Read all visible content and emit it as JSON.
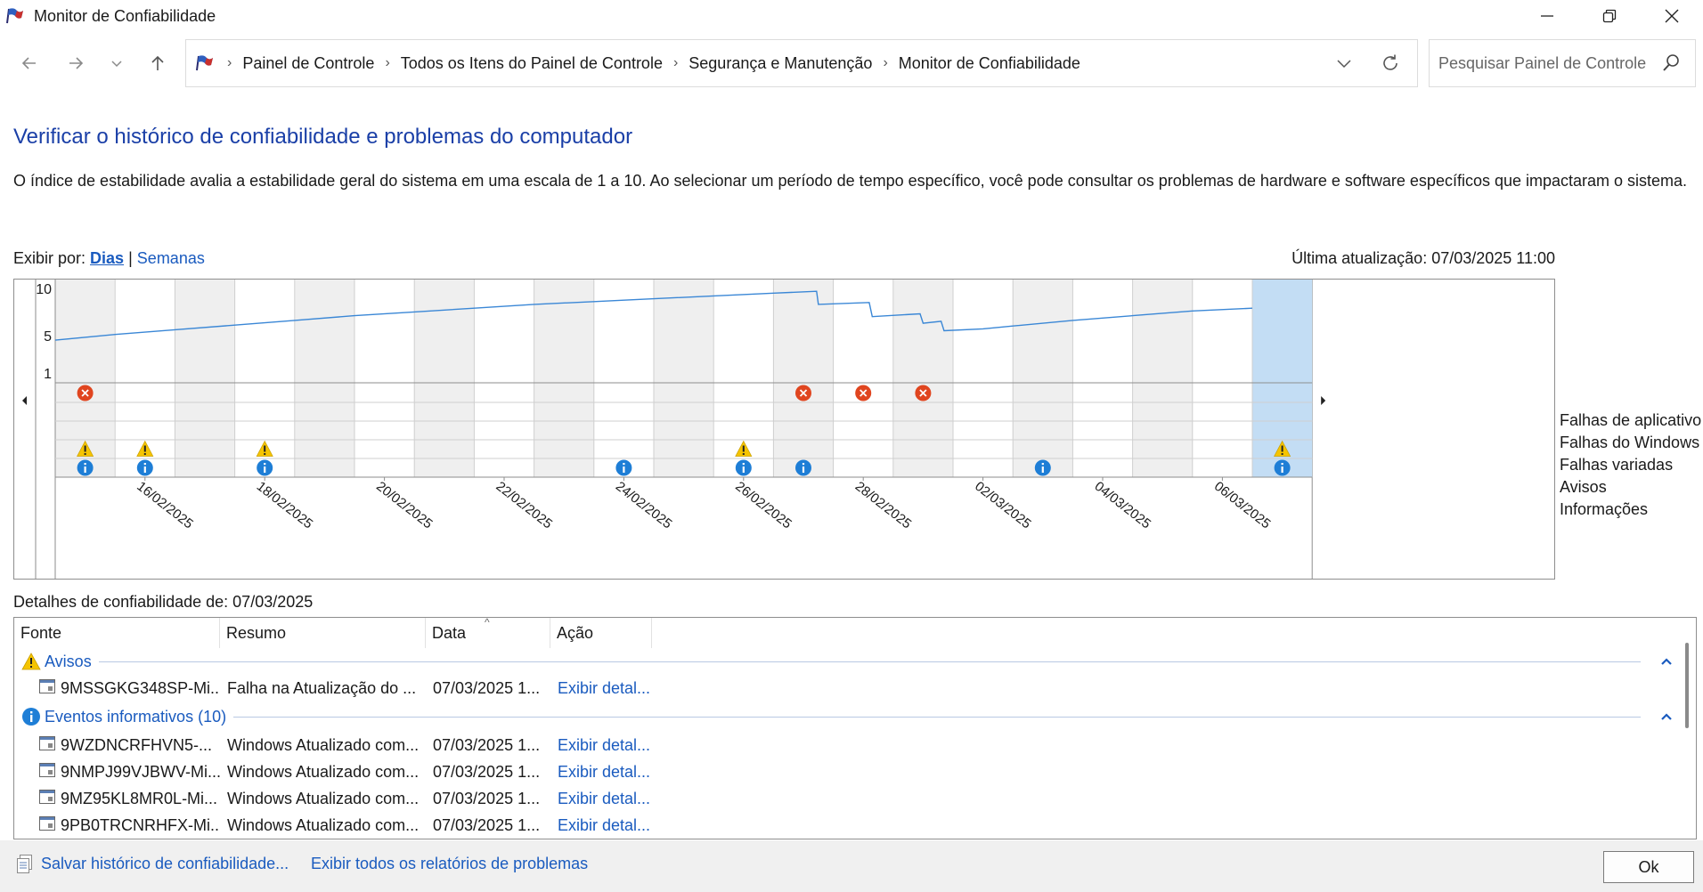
{
  "window": {
    "title": "Monitor de Confiabilidade",
    "controls": [
      "minimize-icon",
      "maximize-icon",
      "close-icon"
    ]
  },
  "address": {
    "crumbs": [
      "Painel de Controle",
      "Todos os Itens do Painel de Controle",
      "Segurança e Manutenção",
      "Monitor de Confiabilidade"
    ],
    "search_placeholder": "Pesquisar Painel de Controle"
  },
  "page": {
    "heading": "Verificar o histórico de confiabilidade e problemas do computador",
    "description": "O índice de estabilidade avalia a estabilidade geral do sistema em uma escala de 1 a 10. Ao selecionar um período de tempo específico, você pode consultar os problemas de hardware e software específicos que impactaram o sistema.",
    "view_by_label": "Exibir por:",
    "view_days": "Dias",
    "view_separator": "|",
    "view_weeks": "Semanas",
    "last_update": "Última atualização: 07/03/2025 11:00"
  },
  "colors": {
    "accent_link": "#1a5bbf",
    "heading": "#1a3fa7",
    "stability_line": "#3a87d6",
    "selected_column": "#c3ddf4",
    "shaded_column": "#efefef",
    "error": "#e0451f",
    "warning": "#f5c400",
    "info": "#1e7ed6"
  },
  "chart_data": {
    "type": "line",
    "title": "",
    "ylabel": "",
    "ylim": [
      1,
      10
    ],
    "y_ticks": [
      "10",
      "5",
      "1"
    ],
    "days": [
      "15/02/2025",
      "16/02/2025",
      "17/02/2025",
      "18/02/2025",
      "19/02/2025",
      "20/02/2025",
      "21/02/2025",
      "22/02/2025",
      "23/02/2025",
      "24/02/2025",
      "25/02/2025",
      "26/02/2025",
      "27/02/2025",
      "28/02/2025",
      "01/03/2025",
      "02/03/2025",
      "03/03/2025",
      "04/03/2025",
      "05/03/2025",
      "06/03/2025",
      "07/03/2025"
    ],
    "x_tick_labels": [
      "16/02/2025",
      "18/02/2025",
      "20/02/2025",
      "22/02/2025",
      "24/02/2025",
      "26/02/2025",
      "28/02/2025",
      "02/03/2025",
      "04/03/2025",
      "06/03/2025"
    ],
    "selected_day": "07/03/2025",
    "series": [
      {
        "points": [
          [
            0,
            4.5
          ],
          [
            1,
            5.1
          ],
          [
            2,
            5.6
          ],
          [
            3,
            6.1
          ],
          [
            4,
            6.6
          ],
          [
            5,
            7.1
          ],
          [
            6,
            7.5
          ],
          [
            7,
            7.9
          ],
          [
            8,
            8.3
          ],
          [
            9,
            8.6
          ],
          [
            10,
            8.9
          ],
          [
            11,
            9.2
          ],
          [
            12,
            9.5
          ],
          [
            12.72,
            9.7
          ],
          [
            12.75,
            8.3
          ],
          [
            13.6,
            8.5
          ],
          [
            13.65,
            7.0
          ],
          [
            14.45,
            7.3
          ],
          [
            14.5,
            6.3
          ],
          [
            14.8,
            6.5
          ],
          [
            14.85,
            5.5
          ],
          [
            15.5,
            5.7
          ],
          [
            16,
            6.0
          ],
          [
            17,
            6.6
          ],
          [
            18,
            7.1
          ],
          [
            19,
            7.6
          ],
          [
            20,
            7.9
          ]
        ]
      }
    ],
    "event_rows": [
      "Falhas de aplicativo",
      "Falhas do Windows",
      "Falhas variadas",
      "Avisos",
      "Informações"
    ],
    "events": {
      "Falhas de aplicativo": [
        "15/02/2025",
        "27/02/2025",
        "28/02/2025",
        "01/03/2025"
      ],
      "Falhas do Windows": [],
      "Falhas variadas": [],
      "Avisos": [
        "15/02/2025",
        "16/02/2025",
        "18/02/2025",
        "26/02/2025",
        "07/03/2025"
      ],
      "Informações": [
        "15/02/2025",
        "16/02/2025",
        "18/02/2025",
        "24/02/2025",
        "26/02/2025",
        "27/02/2025",
        "03/03/2025",
        "07/03/2025"
      ]
    }
  },
  "details": {
    "label": "Detalhes de confiabilidade de: 07/03/2025",
    "columns": [
      "Fonte",
      "Resumo",
      "Data",
      "Ação"
    ],
    "groups": [
      {
        "label": "Avisos",
        "icon": "warning-icon",
        "rows": [
          {
            "source": "9MSSGKG348SP-Mi...",
            "summary": "Falha na Atualização do ...",
            "date": "07/03/2025 1...",
            "action": "Exibir detal..."
          }
        ]
      },
      {
        "label": "Eventos informativos (10)",
        "icon": "info-icon",
        "rows": [
          {
            "source": "9WZDNCRFHVN5-...",
            "summary": "Windows Atualizado com...",
            "date": "07/03/2025 1...",
            "action": "Exibir detal..."
          },
          {
            "source": "9NMPJ99VJBWV-Mi...",
            "summary": "Windows Atualizado com...",
            "date": "07/03/2025 1...",
            "action": "Exibir detal..."
          },
          {
            "source": "9MZ95KL8MR0L-Mi...",
            "summary": "Windows Atualizado com...",
            "date": "07/03/2025 1...",
            "action": "Exibir detal..."
          },
          {
            "source": "9PB0TRCNRHFX-Mi...",
            "summary": "Windows Atualizado com...",
            "date": "07/03/2025 1...",
            "action": "Exibir detal..."
          }
        ]
      }
    ]
  },
  "footer": {
    "save_link": "Salvar histórico de confiabilidade...",
    "reports_link": "Exibir todos os relatórios de problemas",
    "ok_label": "Ok"
  }
}
